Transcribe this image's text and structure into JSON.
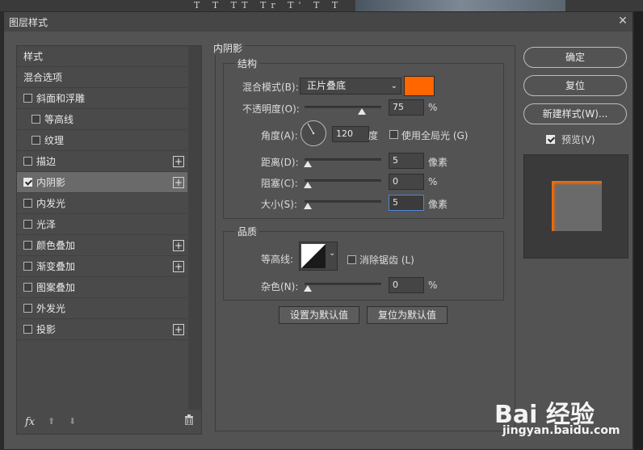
{
  "dialog": {
    "title": "图层样式",
    "close": "✕"
  },
  "style_list": {
    "items": [
      {
        "label": "样式",
        "checkbox": false,
        "checked": false,
        "plus": false,
        "indent": 0,
        "selected": false
      },
      {
        "label": "混合选项",
        "checkbox": false,
        "checked": false,
        "plus": false,
        "indent": 0,
        "selected": false
      },
      {
        "label": "斜面和浮雕",
        "checkbox": true,
        "checked": false,
        "plus": false,
        "indent": 0,
        "selected": false
      },
      {
        "label": "等高线",
        "checkbox": true,
        "checked": false,
        "plus": false,
        "indent": 1,
        "selected": false
      },
      {
        "label": "纹理",
        "checkbox": true,
        "checked": false,
        "plus": false,
        "indent": 1,
        "selected": false
      },
      {
        "label": "描边",
        "checkbox": true,
        "checked": false,
        "plus": true,
        "indent": 0,
        "selected": false
      },
      {
        "label": "内阴影",
        "checkbox": true,
        "checked": true,
        "plus": true,
        "indent": 0,
        "selected": true
      },
      {
        "label": "内发光",
        "checkbox": true,
        "checked": false,
        "plus": false,
        "indent": 0,
        "selected": false
      },
      {
        "label": "光泽",
        "checkbox": true,
        "checked": false,
        "plus": false,
        "indent": 0,
        "selected": false
      },
      {
        "label": "颜色叠加",
        "checkbox": true,
        "checked": false,
        "plus": true,
        "indent": 0,
        "selected": false
      },
      {
        "label": "渐变叠加",
        "checkbox": true,
        "checked": false,
        "plus": true,
        "indent": 0,
        "selected": false
      },
      {
        "label": "图案叠加",
        "checkbox": true,
        "checked": false,
        "plus": false,
        "indent": 0,
        "selected": false
      },
      {
        "label": "外发光",
        "checkbox": true,
        "checked": false,
        "plus": false,
        "indent": 0,
        "selected": false
      },
      {
        "label": "投影",
        "checkbox": true,
        "checked": false,
        "plus": true,
        "indent": 0,
        "selected": false
      }
    ],
    "footer": {
      "fx": "fx",
      "up": "⬆",
      "down": "⬇",
      "trash": "🗑"
    }
  },
  "inner_shadow": {
    "section_title": "内阴影",
    "structure": {
      "legend": "结构",
      "blend_mode_label": "混合模式(B):",
      "blend_mode_value": "正片叠底",
      "color": "#ff6600",
      "opacity_label": "不透明度(O):",
      "opacity_value": "75",
      "opacity_unit": "%",
      "opacity_fraction": 0.75,
      "angle_label": "角度(A):",
      "angle_value": "120",
      "angle_unit": "度",
      "global_light_label": "使用全局光 (G)",
      "global_light_checked": false,
      "distance_label": "距离(D):",
      "distance_value": "5",
      "distance_unit": "像素",
      "choke_label": "阻塞(C):",
      "choke_value": "0",
      "choke_unit": "%",
      "size_label": "大小(S):",
      "size_value": "5",
      "size_unit": "像素"
    },
    "quality": {
      "legend": "品质",
      "contour_label": "等高线:",
      "anti_alias_label": "消除锯齿 (L)",
      "anti_alias_checked": false,
      "noise_label": "杂色(N):",
      "noise_value": "0",
      "noise_unit": "%"
    },
    "set_default": "设置为默认值",
    "reset_default": "复位为默认值"
  },
  "right_panel": {
    "ok": "确定",
    "reset": "复位",
    "new_style": "新建样式(W)...",
    "preview_label": "预览(V)",
    "preview_checked": true
  },
  "background": {
    "toolbar_glyphs": "T T TT Tr T' T T T"
  },
  "watermark": {
    "brand": "Bai 经验",
    "url": "jingyan.baidu.com"
  }
}
